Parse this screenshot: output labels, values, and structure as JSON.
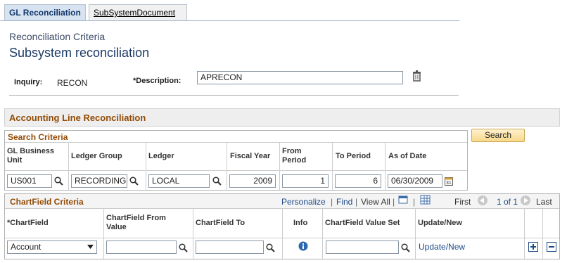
{
  "tabs": [
    {
      "label": "GL Reconciliation",
      "active": true
    },
    {
      "label": "SubSystemDocument",
      "active": false
    }
  ],
  "page": {
    "criteria_title": "Reconciliation Criteria",
    "title": "Subsystem reconciliation"
  },
  "inquiry": {
    "label": "Inquiry:",
    "value": "RECON"
  },
  "description": {
    "label": "*Description:",
    "value": "APRECON"
  },
  "section_title": "Accounting Line Reconciliation",
  "search": {
    "title": "Search Criteria",
    "button": "Search",
    "headers": [
      "GL Business Unit",
      "Ledger Group",
      "Ledger",
      "Fiscal Year",
      "From Period",
      "To Period",
      "As of Date"
    ],
    "values": {
      "business_unit": "US001",
      "ledger_group": "RECORDING",
      "ledger": "LOCAL",
      "fiscal_year": "2009",
      "from_period": "1",
      "to_period": "6",
      "as_of_date": "06/30/2009"
    }
  },
  "chartfield": {
    "title": "ChartField Criteria",
    "personalize": "Personalize",
    "find": "Find",
    "view_all": "View All",
    "first": "First",
    "range": "1 of 1",
    "last": "Last",
    "headers": [
      "*ChartField",
      "ChartField From Value",
      "ChartField To",
      "Info",
      "ChartField Value Set",
      "Update/New"
    ],
    "row": {
      "chartfield": "Account",
      "from_value": "",
      "to_value": "",
      "value_set": "",
      "update_link": "Update/New"
    }
  },
  "colors": {
    "section_title": "#924b05",
    "link": "#1c4a86",
    "active_tab_bg": "#d7e3f0"
  }
}
